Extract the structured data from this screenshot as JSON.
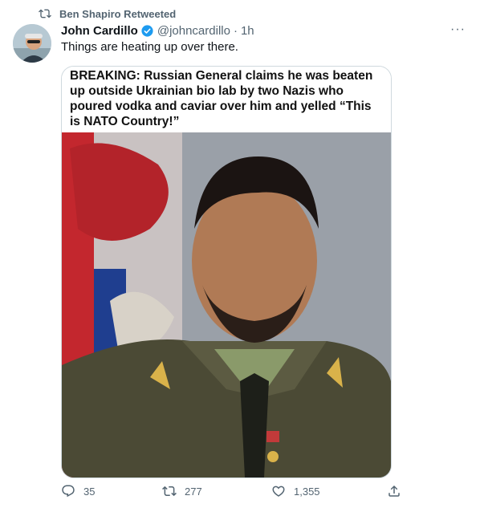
{
  "retweet": {
    "label": "Ben Shapiro Retweeted"
  },
  "tweet": {
    "display_name": "John Cardillo",
    "handle": "@johncardillo",
    "separator": "·",
    "time": "1h",
    "more": "···",
    "text": "Things are heating up over there.",
    "media_caption": "BREAKING: Russian General claims he was beaten up outside Ukrainian bio lab by two Nazis who poured vodka and caviar over him and yelled “This is NATO Country!”"
  },
  "actions": {
    "replies": "35",
    "retweets": "277",
    "likes": "1,355"
  },
  "colors": {
    "secondary": "#536471",
    "verified": "#1d9bf0"
  },
  "icons": [
    "retweet-icon",
    "verified-badge-icon",
    "more-icon",
    "reply-icon",
    "like-icon",
    "share-icon"
  ]
}
